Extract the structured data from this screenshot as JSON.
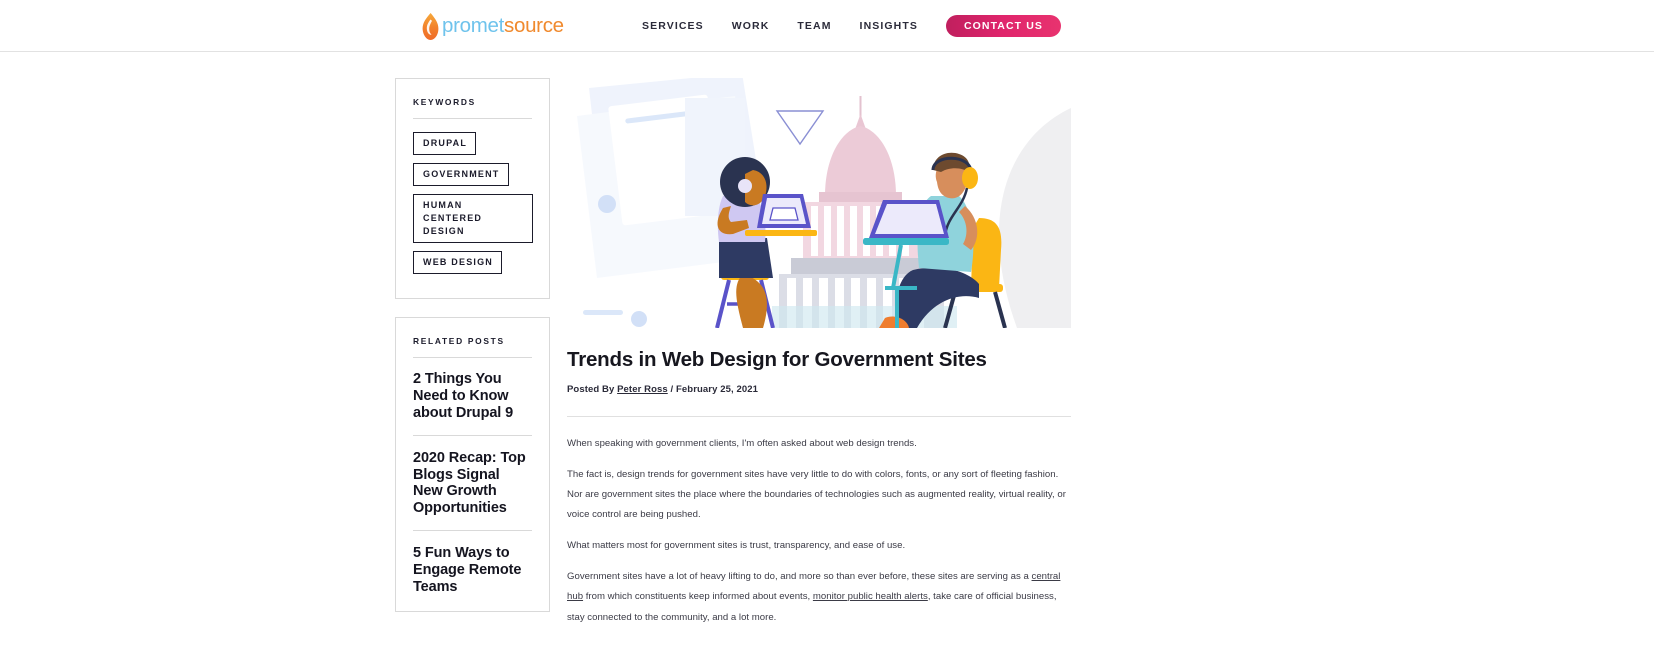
{
  "header": {
    "logo": {
      "icon": "flame-icon",
      "text_first": "promet",
      "text_second": "source",
      "color_first": "#6fc3ec",
      "color_second": "#f08a2e"
    },
    "nav": [
      {
        "label": "SERVICES"
      },
      {
        "label": "WORK"
      },
      {
        "label": "TEAM"
      },
      {
        "label": "INSIGHTS"
      }
    ],
    "cta": {
      "label": "CONTACT US",
      "color": "#e0256c"
    }
  },
  "sidebar": {
    "keywords_panel": {
      "title": "KEYWORDS",
      "tags": [
        {
          "label": "DRUPAL",
          "wide": false
        },
        {
          "label": "GOVERNMENT",
          "wide": false
        },
        {
          "label": "HUMAN CENTERED DESIGN",
          "wide": true
        },
        {
          "label": "WEB DESIGN",
          "wide": false
        }
      ]
    },
    "related_panel": {
      "title": "RELATED POSTS",
      "posts": [
        {
          "title": "2 Things You Need to Know about Drupal 9"
        },
        {
          "title": "2020 Recap: Top Blogs Signal New Growth Opportunities"
        },
        {
          "title": "5 Fun Ways to Engage Remote Teams"
        }
      ]
    }
  },
  "article": {
    "hero_alt": "Illustration of two people working on laptops in front of a government capitol building",
    "title": "Trends in Web Design for Government Sites",
    "byline": {
      "prefix": "Posted By",
      "author": "Peter Ross",
      "separator": "/",
      "date": "February 25, 2021"
    },
    "paragraphs": [
      {
        "text": "When speaking with government clients, I'm often asked about web design trends."
      },
      {
        "text": "The fact is, design trends for government sites have very little to do with colors, fonts, or any sort of fleeting fashion. Nor are government sites the place where the boundaries of technologies such as augmented reality, virtual reality, or voice control are being pushed."
      },
      {
        "text": "What matters most for government sites is trust, transparency, and ease of use."
      }
    ],
    "final_paragraph": {
      "part1": "Government sites have a lot of heavy lifting to do, and more so than ever before, these sites are serving as a ",
      "link1": "central hub",
      "part2": " from which constituents keep informed about events, ",
      "link2": "monitor public health alerts",
      "part3": ", take care of official business, stay connected to the community, and a lot more."
    }
  }
}
